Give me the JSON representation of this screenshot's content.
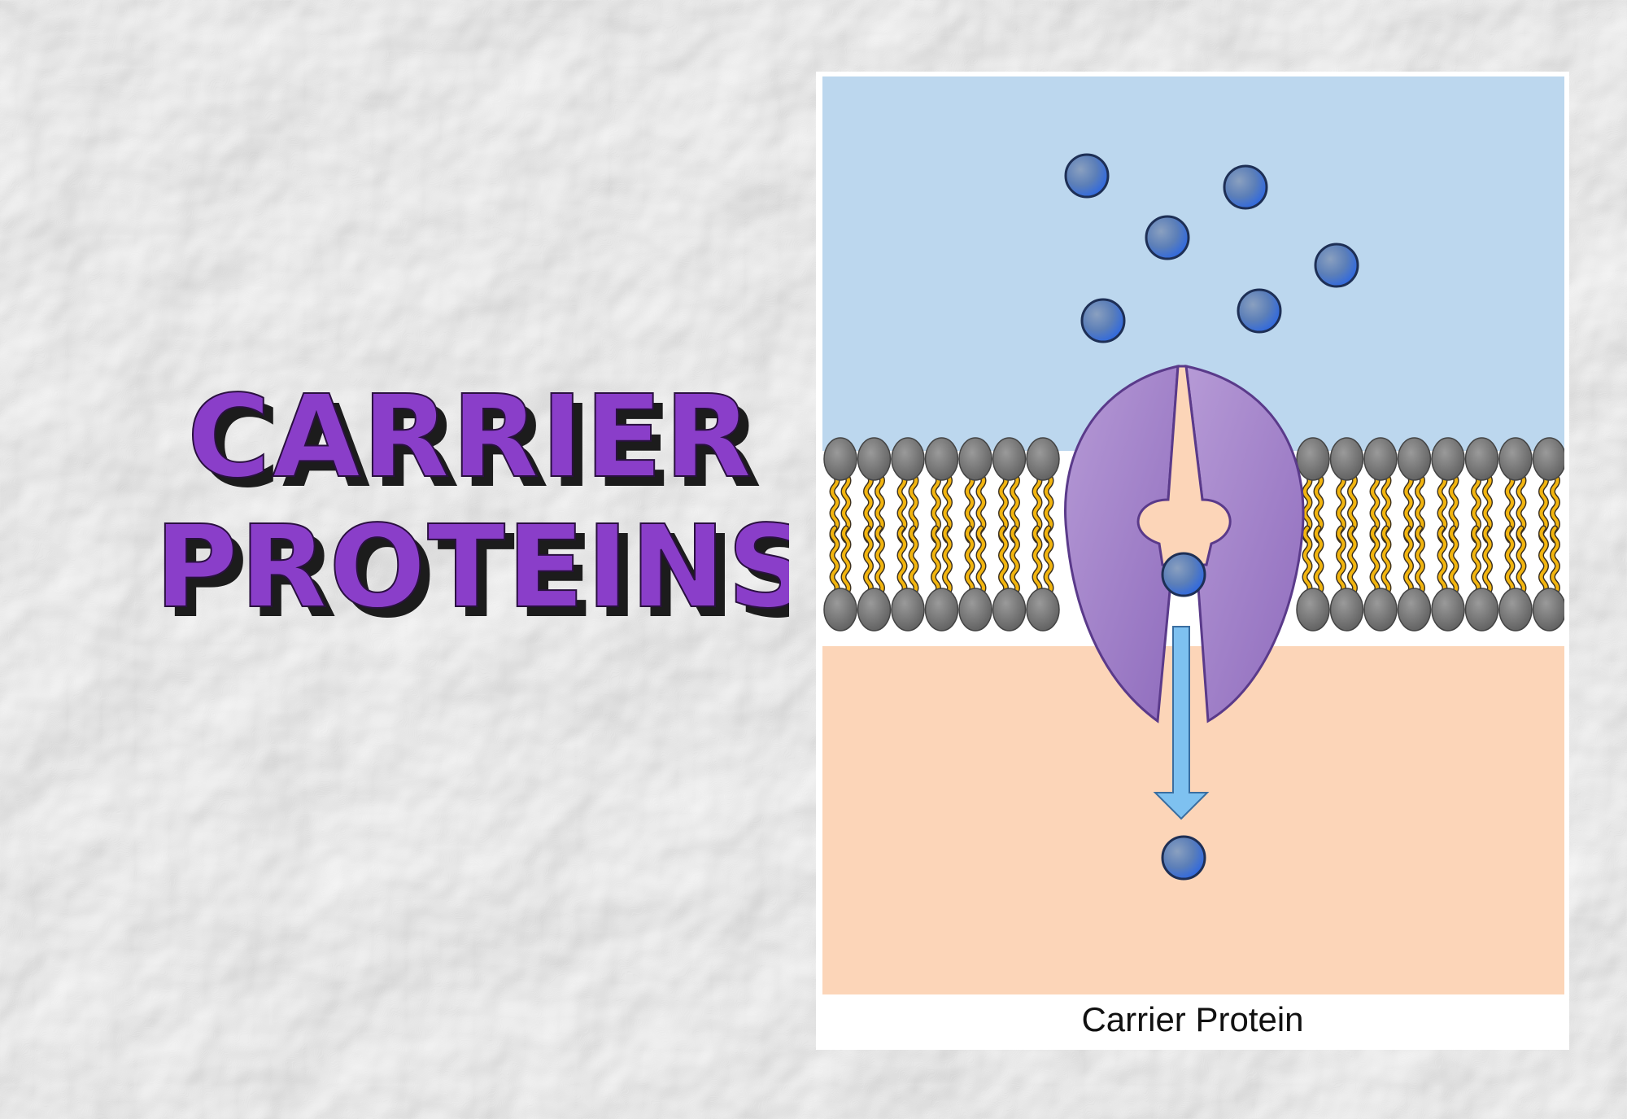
{
  "title": {
    "line1": "CARRIER",
    "line2": "PROTEINS"
  },
  "figure": {
    "caption": "Carrier Protein"
  },
  "colors": {
    "paper": "#eeeeee",
    "title_fill": "#8a3ec9",
    "title_shadow": "#1c1c1c",
    "extracellular": "#bcd7ee",
    "intracellular": "#fcd5b8",
    "phospholipid_head": "#777777",
    "lipid_tail": "#f2b50f",
    "protein": "#9a76c2",
    "protein_outline": "#5a3a8a",
    "solute": "#3a78d8",
    "arrow": "#7ec1f0"
  },
  "icons": {
    "solute": "sphere",
    "transport_direction": "arrow-down"
  }
}
